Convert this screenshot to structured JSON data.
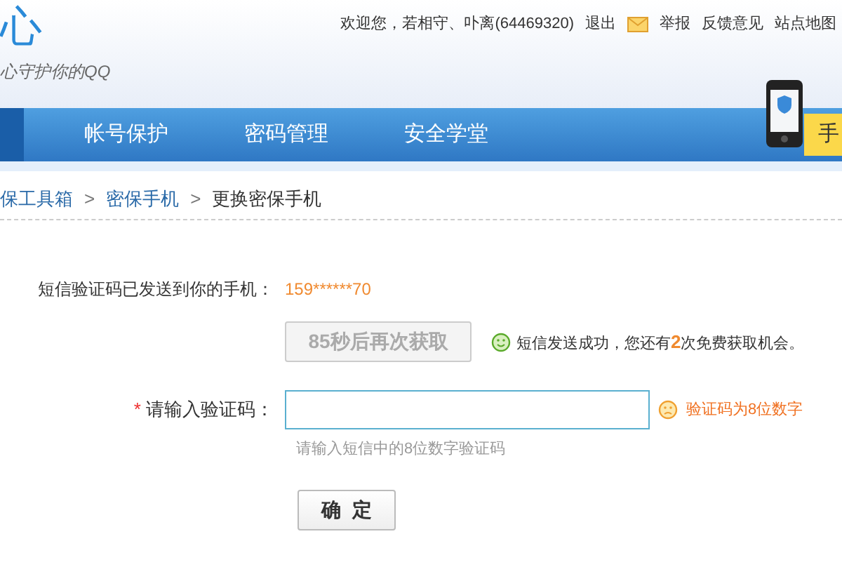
{
  "logo": {
    "title": "心",
    "tagline": "心守护你的QQ"
  },
  "top_links": {
    "welcome": "欢迎您，若相守、卟离(64469320)",
    "items": [
      {
        "kind": "text",
        "label": "退出"
      },
      {
        "kind": "mail"
      },
      {
        "kind": "text",
        "label": "举报"
      },
      {
        "kind": "text",
        "label": "反馈意见"
      },
      {
        "kind": "text",
        "label": "站点地图"
      }
    ]
  },
  "nav": {
    "tabs": [
      {
        "label": "帐号保护",
        "selected": false
      },
      {
        "label": "密码管理",
        "selected": false
      },
      {
        "label": "安全学堂",
        "selected": false
      }
    ],
    "promo": "手"
  },
  "breadcrumb": [
    {
      "label": "保工具箱",
      "link": true
    },
    {
      "label": "密保手机",
      "link": true,
      "separator": ">"
    },
    {
      "label": "更换密保手机",
      "link": false,
      "separator": ">"
    }
  ],
  "form": {
    "sent_label": "短信验证码已发送到你的手机：",
    "phone": "159******70",
    "resend_button": {
      "label": "85秒后再次获取",
      "disabled": true
    },
    "sms_status": "短信发送成功，您还有**2**次免费获取机会。",
    "code_label": "请输入验证码：",
    "required_mark": "*",
    "code_error": "验证码为8位数字",
    "code_hint": "请输入短信中的8位数字验证码",
    "submit": "确  定"
  }
}
